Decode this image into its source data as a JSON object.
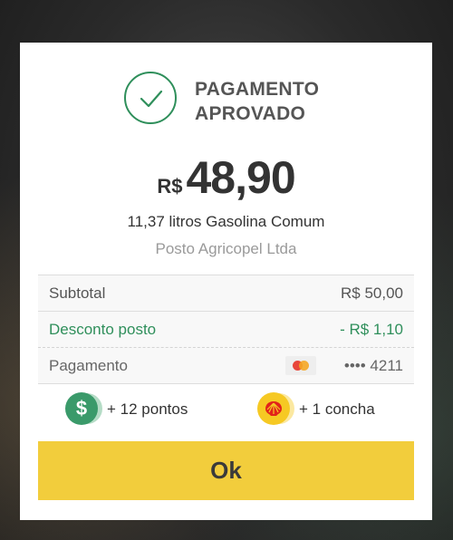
{
  "status": {
    "title": "PAGAMENTO APROVADO"
  },
  "amount": {
    "currency": "R$",
    "value": "48,90"
  },
  "fuel": "11,37 litros Gasolina Comum",
  "station": "Posto Agricopel Ltda",
  "lines": {
    "subtotal": {
      "label": "Subtotal",
      "value": "R$ 50,00"
    },
    "discount": {
      "label": "Desconto posto",
      "value": "- R$ 1,10"
    },
    "payment": {
      "label": "Pagamento",
      "card": "•••• 4211",
      "card_icon": "mastercard-icon"
    }
  },
  "rewards": {
    "points": "+ 12 pontos",
    "shells": "+ 1 concha"
  },
  "button": {
    "ok": "Ok"
  },
  "colors": {
    "accent_green": "#2f8f5b",
    "button_yellow": "#f2cd3c"
  }
}
